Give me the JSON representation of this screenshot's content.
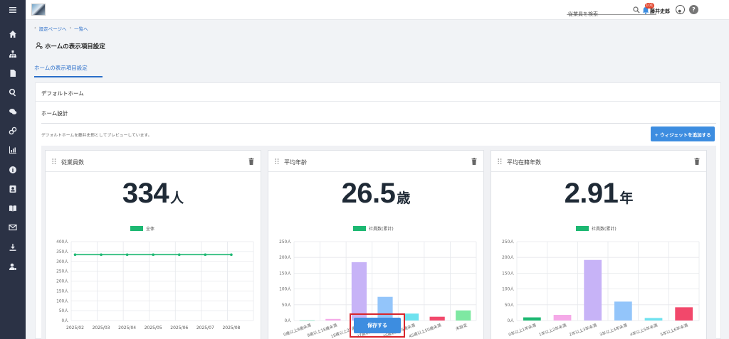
{
  "sidebar": {
    "menu_icon": "hamburger-icon",
    "items": [
      {
        "icon": "home-icon"
      },
      {
        "icon": "org-chart-icon"
      },
      {
        "icon": "document-icon"
      },
      {
        "icon": "search-icon"
      },
      {
        "icon": "chat-icon"
      },
      {
        "icon": "link-icon"
      },
      {
        "icon": "bar-chart-icon"
      },
      {
        "icon": "info-icon"
      },
      {
        "icon": "contact-card-icon"
      },
      {
        "icon": "book-icon"
      },
      {
        "icon": "mail-icon"
      },
      {
        "icon": "download-icon"
      },
      {
        "icon": "user-settings-icon"
      }
    ]
  },
  "header": {
    "search_placeholder": "従業員を検索",
    "notification_count": "101",
    "user_name": "藤井史郎",
    "help_label": "?"
  },
  "breadcrumb": {
    "back_settings": "設定ページへ",
    "back_list": "一覧へ"
  },
  "page": {
    "title": "ホームの表示項目設定",
    "tab": "ホームの表示項目設定"
  },
  "card": {
    "header": "デフォルトホーム",
    "section_title": "ホーム設計",
    "preview_note": "デフォルトホームを藤井史郎としてプレビューしています。",
    "add_widget_label": "+ ウィジェットを追加する"
  },
  "widgets": [
    {
      "title": "従業員数",
      "value": "334",
      "unit": "人",
      "chart_data": {
        "type": "line",
        "legend": [
          "全体"
        ],
        "series": [
          {
            "name": "全体",
            "color": "#1db872",
            "values": [
              334,
              334,
              334,
              334,
              334,
              334,
              334
            ]
          }
        ],
        "categories": [
          "2025/02",
          "2025/03",
          "2025/04",
          "2025/05",
          "2025/06",
          "2025/07",
          "2025/08"
        ],
        "yticks": [
          "0人",
          "50人",
          "100人",
          "150人",
          "200人",
          "250人",
          "300人",
          "350人",
          "400人"
        ],
        "ylim": [
          0,
          400
        ]
      }
    },
    {
      "title": "平均年齢",
      "value": "26.5",
      "unit": "歳",
      "chart_data": {
        "type": "bar",
        "legend": [
          "社員数(累計)"
        ],
        "legend_color": "#1db872",
        "categories": [
          "0歳以上9歳未満",
          "9歳以上18歳未満",
          "18歳以上27歳未満",
          "27歳以上36歳未満",
          "36歳以上45歳未満",
          "45歳以上50歳未満",
          "未設定"
        ],
        "values": [
          1,
          5,
          185,
          75,
          22,
          12,
          32
        ],
        "colors": [
          "#8fe0c3",
          "#f5a9e8",
          "#c7b3f7",
          "#93c5fa",
          "#6ee2ef",
          "#f2486b",
          "#7ee8a2"
        ],
        "yticks": [
          "0人",
          "50人",
          "100人",
          "150人",
          "200人",
          "250人"
        ],
        "ylim": [
          0,
          250
        ]
      }
    },
    {
      "title": "平均在籍年数",
      "value": "2.91",
      "unit": "年",
      "chart_data": {
        "type": "bar",
        "legend": [
          "社員数(累計)"
        ],
        "legend_color": "#1db872",
        "categories": [
          "0年以上1年未満",
          "1年以上2年未満",
          "2年以上3年未満",
          "3年以上4年未満",
          "4年以上5年未満",
          "5年以上6年未満"
        ],
        "values": [
          10,
          18,
          192,
          60,
          8,
          42
        ],
        "colors": [
          "#1db872",
          "#f5a9e8",
          "#c7b3f7",
          "#93c5fa",
          "#6ee2ef",
          "#f2486b"
        ],
        "yticks": [
          "0人",
          "50人",
          "100人",
          "150人",
          "200人",
          "250人"
        ],
        "ylim": [
          0,
          250
        ]
      }
    }
  ],
  "save_label": "保存する"
}
